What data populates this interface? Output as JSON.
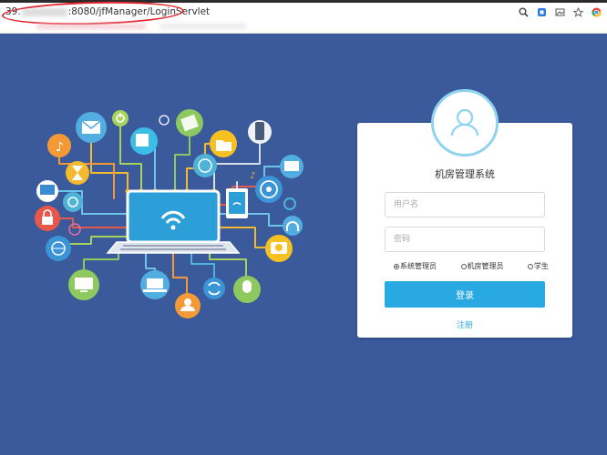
{
  "browser": {
    "url_prefix": "39.",
    "url_suffix": ":8080/jfManager/LoginServlet",
    "toolbar_icons": [
      "zoom-icon",
      "shield-icon",
      "image-icon",
      "star-icon",
      "chrome-icon"
    ]
  },
  "login": {
    "system_title": "机房管理系统",
    "username_placeholder": "用户名",
    "password_placeholder": "密码",
    "roles": [
      {
        "label": "系统管理员",
        "selected": true
      },
      {
        "label": "机房管理员",
        "selected": false
      },
      {
        "label": "学生",
        "selected": false
      }
    ],
    "login_label": "登录",
    "register_label": "注册"
  },
  "colors": {
    "background": "#3a5a9c",
    "accent": "#29a9e1",
    "annotation": "#e0262c"
  }
}
